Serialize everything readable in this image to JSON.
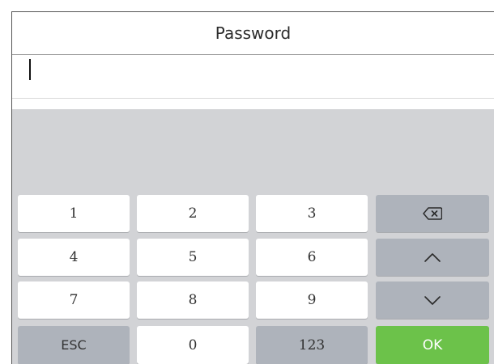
{
  "title": "Password",
  "password_input": {
    "value": ""
  },
  "keypad": {
    "key_1": "1",
    "key_2": "2",
    "key_3": "3",
    "key_4": "4",
    "key_5": "5",
    "key_6": "6",
    "key_7": "7",
    "key_8": "8",
    "key_9": "9",
    "key_0": "0",
    "esc": "ESC",
    "mode": "123",
    "ok": "OK",
    "backspace_icon": "backspace-icon",
    "up_icon": "chevron-up-icon",
    "down_icon": "chevron-down-icon"
  },
  "colors": {
    "keyboard_bg": "#d2d3d6",
    "key_light": "#ffffff",
    "key_dark": "#aeb3bb",
    "ok": "#6cc24a"
  }
}
